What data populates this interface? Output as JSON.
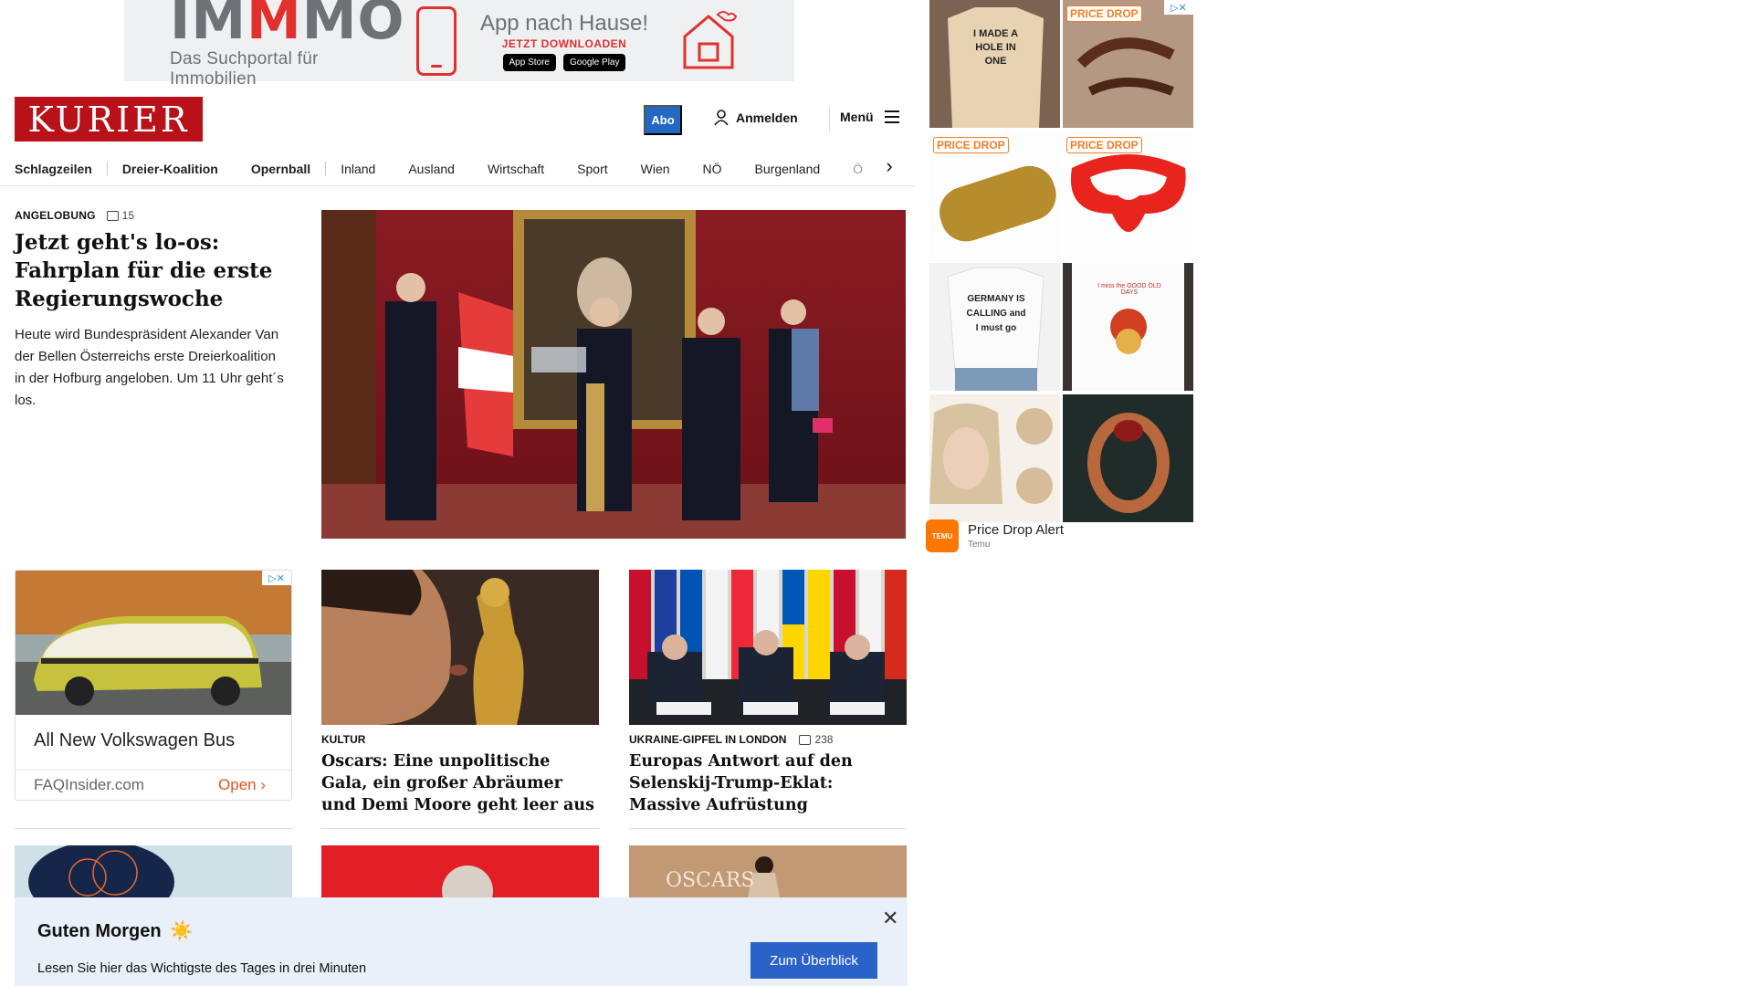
{
  "top_ad": {
    "logo_parts": [
      "IM",
      "M",
      "MO"
    ],
    "tagline": "Das Suchportal für Immobilien",
    "app_title": "App nach Hause!",
    "download": "JETZT DOWNLOADEN",
    "app_store": "App Store",
    "google_play": "Google Play"
  },
  "header": {
    "logo": "KURIER",
    "abo": "Abo",
    "login": "Anmelden",
    "menu": "Menü"
  },
  "nav": {
    "items": [
      "Schlagzeilen",
      "Dreier-Koalition",
      "Opernball",
      "Inland",
      "Ausland",
      "Wirtschaft",
      "Sport",
      "Wien",
      "NÖ",
      "Burgenland",
      "Ö"
    ]
  },
  "lead": {
    "kicker": "ANGELOBUNG",
    "comments": "15",
    "title": "Jetzt geht's lo-os: Fahrplan für die erste Regierungswoche",
    "text": "Heute wird Bundespräsident Alexander Van der Bellen Österreichs erste Dreierkoalition in der Hofburg angeloben. Um 11 Uhr geht´s los."
  },
  "vw_ad": {
    "title": "All New Volkswagen Bus",
    "domain": "FAQInsider.com",
    "cta": "Open"
  },
  "cards": [
    {
      "kicker": "KULTUR",
      "comments": "",
      "title": "Oscars: Eine unpolitische Gala, ein großer Abräumer und Demi Moore geht leer aus"
    },
    {
      "kicker": "UKRAINE-GIPFEL IN LONDON",
      "comments": "238",
      "title": "Europas Antwort auf den Selenskij-Trump-Eklat: Massive Aufrüstung"
    }
  ],
  "partial_text": "OSCARS",
  "morning": {
    "title": "Guten Morgen",
    "emoji": "☀️",
    "text": "Lesen Sie hier das Wichtigste des Tages in drei Minuten",
    "button": "Zum Überblick"
  },
  "right_ad": {
    "badge": "PRICE DROP",
    "shirt_1": "I MADE A HOLE IN ONE",
    "shirt_2": "GERMANY IS CALLING and I must go",
    "shirt_3": "I miss the GOOD OLD DAYS",
    "temu_logo": "TEMU",
    "title": "Price Drop Alert",
    "subtitle": "Temu"
  },
  "colors": {
    "brand_red": "#b9111a",
    "abo_blue": "#2568c4",
    "button_blue": "#2a62c9",
    "price_drop_orange": "#f47e20",
    "banner_bg": "#e9f0f9"
  }
}
